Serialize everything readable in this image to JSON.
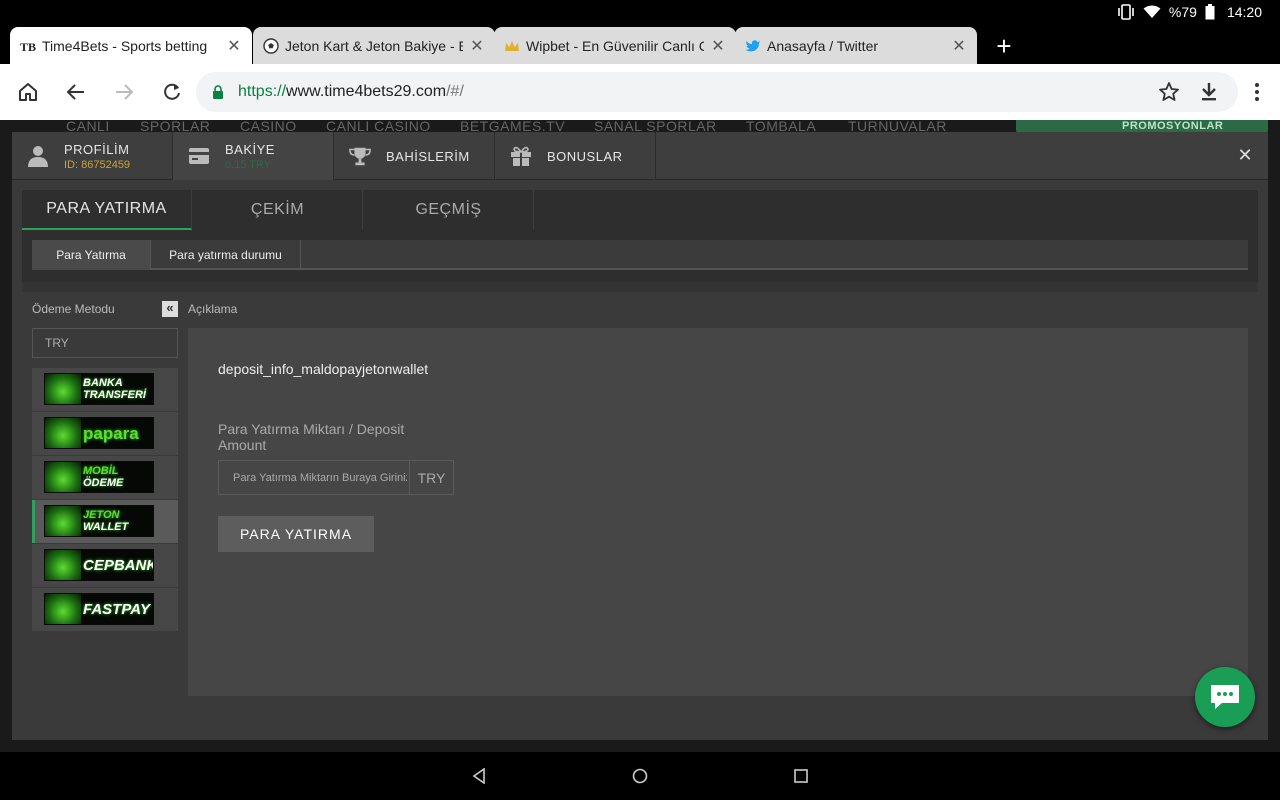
{
  "status_bar": {
    "battery": "%79",
    "time": "14:20"
  },
  "tabs": [
    {
      "title": "Time4Bets - Sports betting",
      "favicon": "time4bets-logo-icon",
      "active": true
    },
    {
      "title": "Jeton Kart & Jeton Bakiye - E",
      "favicon": "soccer-ball-icon",
      "active": false
    },
    {
      "title": "Wipbet - En Güvenilir Canlı Ca",
      "favicon": "crown-icon",
      "active": false
    },
    {
      "title": "Anasayfa / Twitter",
      "favicon": "twitter-bird-icon",
      "active": false
    }
  ],
  "address_bar": {
    "scheme": "https://",
    "host": "www.time4bets29.com",
    "path": "/#/"
  },
  "site_nav": [
    "CANLI",
    "SPORLAR",
    "CASINO",
    "CANLI CASINO",
    "BETGAMES.TV",
    "SANAL SPORLAR",
    "TOMBALA",
    "TURNUVALAR"
  ],
  "promo": "PROMOSYONLAR",
  "modal": {
    "tabs": [
      {
        "label": "PROFİLİM",
        "sub": "ID: 86752459",
        "icon": "user-icon"
      },
      {
        "label": "BAKİYE",
        "sub": "0.15 TRY",
        "icon": "wallet-card-icon"
      },
      {
        "label": "BAHİSLERİM",
        "sub": "",
        "icon": "trophy-icon"
      },
      {
        "label": "BONUSLAR",
        "sub": "",
        "icon": "gift-icon"
      }
    ],
    "close_icon": "close-icon"
  },
  "section_tabs": [
    "PARA YATIRMA",
    "ÇEKİM",
    "GEÇMİŞ"
  ],
  "sub_tabs": [
    "Para Yatırma",
    "Para yatırma durumu"
  ],
  "payment": {
    "method_label": "Ödeme Metodu",
    "currency": "TRY",
    "methods": [
      {
        "line1": "BANKA",
        "line2": "TRANSFERİ"
      },
      {
        "line1": "papara",
        "line2": ""
      },
      {
        "line1": "MOBİL",
        "line2": "ÖDEME"
      },
      {
        "line1": "JETON",
        "line2": "WALLET"
      },
      {
        "line1": "CEPBANK",
        "line2": ""
      },
      {
        "line1": "FASTPAY",
        "line2": ""
      }
    ]
  },
  "description": {
    "label": "Açıklama",
    "info_key": "deposit_info_maldopayjetonwallet",
    "amount_label": "Para Yatırma Miktarı / Deposit Amount",
    "amount_placeholder": "Para Yatırma Miktarın Buraya Giriniz",
    "amount_currency": "TRY",
    "submit": "PARA YATIRMA"
  }
}
